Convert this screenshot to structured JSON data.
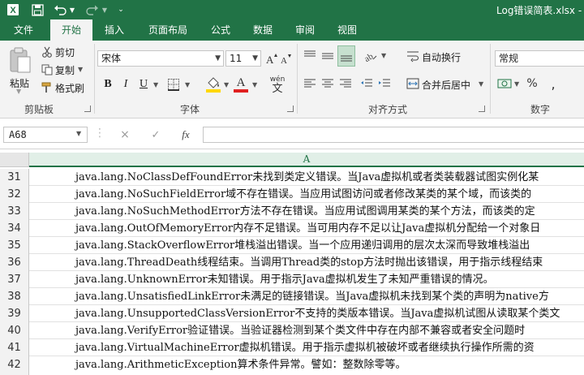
{
  "titlebar": {
    "doc_title": "Log错误简表.xlsx -",
    "icons": [
      "excel-logo-icon",
      "save-icon",
      "undo-icon",
      "redo-icon",
      "customize-qat-icon"
    ]
  },
  "tabs": [
    {
      "label": "文件"
    },
    {
      "label": "开始"
    },
    {
      "label": "插入"
    },
    {
      "label": "页面布局"
    },
    {
      "label": "公式"
    },
    {
      "label": "数据"
    },
    {
      "label": "审阅"
    },
    {
      "label": "视图"
    }
  ],
  "ribbon": {
    "clipboard": {
      "paste": "粘贴",
      "cut": "剪切",
      "copy": "复制",
      "format_painter": "格式刷",
      "group_label": "剪贴板"
    },
    "font": {
      "font_name": "宋体",
      "font_size": "11",
      "bold": "B",
      "italic": "I",
      "underline": "U",
      "font_color_letter": "A",
      "wen": "wén",
      "wen_char": "文",
      "group_label": "字体"
    },
    "alignment": {
      "wrap_text": "自动换行",
      "merge_center": "合并后居中",
      "group_label": "对齐方式"
    },
    "number": {
      "format": "常规",
      "percent": "%",
      "group_label": "数字"
    },
    "accent_color": "#217346",
    "font_color": "#e02020",
    "fill_color": "#ffd700"
  },
  "formula_bar": {
    "name_box": "A68",
    "cancel": "×",
    "enter": "✓",
    "fx": "fx"
  },
  "sheet": {
    "column_header": "A",
    "rows": [
      {
        "num": "31",
        "text": "java.lang.NoClassDefFoundError未找到类定义错误。当Java虚拟机或者类装载器试图实例化某"
      },
      {
        "num": "32",
        "text": "java.lang.NoSuchFieldError域不存在错误。当应用试图访问或者修改某类的某个域，而该类的"
      },
      {
        "num": "33",
        "text": "java.lang.NoSuchMethodError方法不存在错误。当应用试图调用某类的某个方法，而该类的定"
      },
      {
        "num": "34",
        "text": "java.lang.OutOfMemoryError内存不足错误。当可用内存不足以让Java虚拟机分配给一个对象日"
      },
      {
        "num": "35",
        "text": "java.lang.StackOverflowError堆栈溢出错误。当一个应用递归调用的层次太深而导致堆栈溢出"
      },
      {
        "num": "36",
        "text": "java.lang.ThreadDeath线程结束。当调用Thread类的stop方法时抛出该错误，用于指示线程结束"
      },
      {
        "num": "37",
        "text": "java.lang.UnknownError未知错误。用于指示Java虚拟机发生了未知严重错误的情况。"
      },
      {
        "num": "38",
        "text": "java.lang.UnsatisfiedLinkError未满足的链接错误。当Java虚拟机未找到某个类的声明为native方"
      },
      {
        "num": "39",
        "text": "java.lang.UnsupportedClassVersionError不支持的类版本错误。当Java虚拟机试图从读取某个类文"
      },
      {
        "num": "40",
        "text": "java.lang.VerifyError验证错误。当验证器检测到某个类文件中存在内部不兼容或者安全问题时"
      },
      {
        "num": "41",
        "text": "java.lang.VirtualMachineError虚拟机错误。用于指示虚拟机被破坏或者继续执行操作所需的资"
      },
      {
        "num": "42",
        "text": "java.lang.ArithmeticException算术条件异常。譬如：整数除零等。"
      }
    ]
  }
}
